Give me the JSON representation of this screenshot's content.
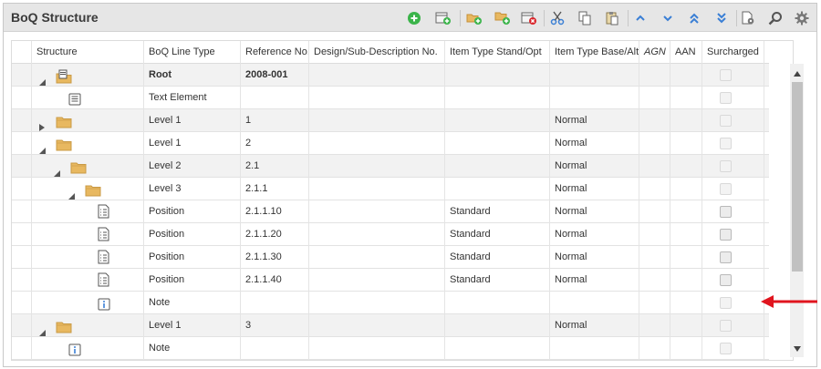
{
  "panel": {
    "title": "BoQ Structure"
  },
  "toolbar": {
    "buttons": [
      {
        "name": "add-icon"
      },
      {
        "name": "new-record-icon"
      },
      {
        "name": "new-level-icon"
      },
      {
        "name": "new-sublevel-icon"
      },
      {
        "name": "delete-icon"
      },
      {
        "name": "cut-icon"
      },
      {
        "name": "copy-icon"
      },
      {
        "name": "paste-icon"
      },
      {
        "name": "move-up-icon"
      },
      {
        "name": "move-down-icon"
      },
      {
        "name": "move-top-icon"
      },
      {
        "name": "move-bottom-icon"
      },
      {
        "name": "document-settings-icon"
      },
      {
        "name": "search-icon"
      },
      {
        "name": "gear-icon"
      }
    ]
  },
  "columns": [
    {
      "label": "Structure"
    },
    {
      "label": "BoQ Line Type"
    },
    {
      "label": "Reference No."
    },
    {
      "label": "Design/Sub-Description No."
    },
    {
      "label": "Item Type Stand/Opt"
    },
    {
      "label": "Item Type Base/Alt"
    },
    {
      "label": "AGN"
    },
    {
      "label": "AAN"
    },
    {
      "label": "Surcharged"
    }
  ],
  "rows": [
    {
      "indent": 0,
      "expander": "expanded",
      "icon": "root",
      "type": "Root",
      "ref": "2008-001",
      "design": "",
      "standopt": "",
      "basealt": "",
      "surcharged": false,
      "enabled": false
    },
    {
      "indent": 1,
      "expander": "none",
      "icon": "text",
      "type": "Text Element",
      "ref": "",
      "design": "",
      "standopt": "",
      "basealt": "",
      "surcharged": false,
      "enabled": false
    },
    {
      "indent": 0,
      "expander": "collapsed",
      "icon": "folder",
      "type": "Level 1",
      "ref": "1",
      "design": "",
      "standopt": "",
      "basealt": "Normal",
      "surcharged": false,
      "enabled": false
    },
    {
      "indent": 0,
      "expander": "expanded",
      "icon": "folder",
      "type": "Level 1",
      "ref": "2",
      "design": "",
      "standopt": "",
      "basealt": "Normal",
      "surcharged": false,
      "enabled": false
    },
    {
      "indent": 1,
      "expander": "expanded",
      "icon": "folder",
      "type": "Level 2",
      "ref": "2.1",
      "design": "",
      "standopt": "",
      "basealt": "Normal",
      "surcharged": false,
      "enabled": false
    },
    {
      "indent": 2,
      "expander": "expanded",
      "icon": "folder",
      "type": "Level 3",
      "ref": "2.1.1",
      "design": "",
      "standopt": "",
      "basealt": "Normal",
      "surcharged": false,
      "enabled": false
    },
    {
      "indent": 3,
      "expander": "none",
      "icon": "position",
      "type": "Position",
      "ref": "2.1.1.10",
      "design": "",
      "standopt": "Standard",
      "basealt": "Normal",
      "surcharged": false,
      "enabled": true
    },
    {
      "indent": 3,
      "expander": "none",
      "icon": "position",
      "type": "Position",
      "ref": "2.1.1.20",
      "design": "",
      "standopt": "Standard",
      "basealt": "Normal",
      "surcharged": false,
      "enabled": true
    },
    {
      "indent": 3,
      "expander": "none",
      "icon": "position",
      "type": "Position",
      "ref": "2.1.1.30",
      "design": "",
      "standopt": "Standard",
      "basealt": "Normal",
      "surcharged": false,
      "enabled": true
    },
    {
      "indent": 3,
      "expander": "none",
      "icon": "position",
      "type": "Position",
      "ref": "2.1.1.40",
      "design": "",
      "standopt": "Standard",
      "basealt": "Normal",
      "surcharged": false,
      "enabled": true
    },
    {
      "indent": 3,
      "expander": "none",
      "icon": "note",
      "type": "Note",
      "ref": "",
      "design": "",
      "standopt": "",
      "basealt": "",
      "surcharged": false,
      "enabled": false
    },
    {
      "indent": 0,
      "expander": "expanded",
      "icon": "folder",
      "type": "Level 1",
      "ref": "3",
      "design": "",
      "standopt": "",
      "basealt": "Normal",
      "surcharged": false,
      "enabled": false
    },
    {
      "indent": 1,
      "expander": "none",
      "icon": "note",
      "type": "Note",
      "ref": "",
      "design": "",
      "standopt": "",
      "basealt": "",
      "surcharged": false,
      "enabled": false
    }
  ],
  "colors": {
    "header_bg": "#e6e6e6",
    "alt_row": "#f2f2f2",
    "toolbar_blue": "#3a7fd5",
    "green_add": "#3bb44a",
    "red_delete": "#d9262c",
    "folder": "#e8b860",
    "annotation_arrow": "#e0141e"
  }
}
